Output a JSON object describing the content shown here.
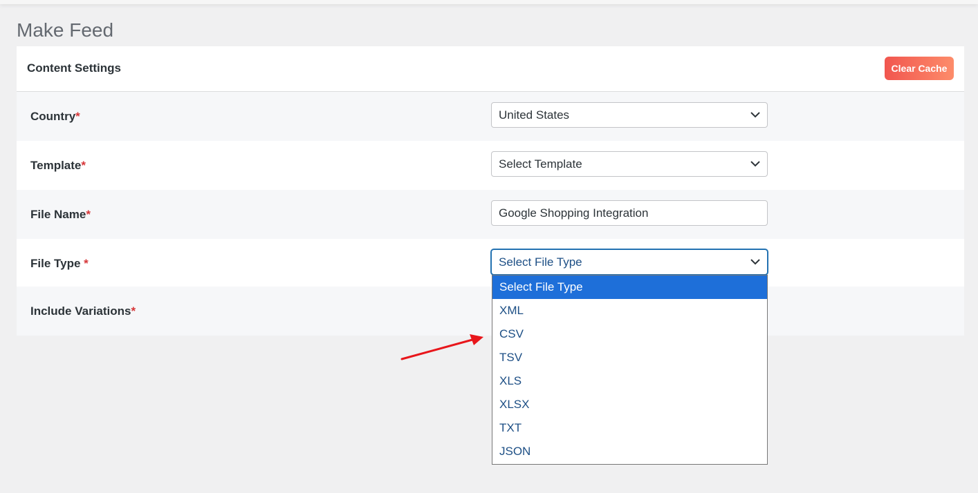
{
  "page": {
    "title": "Make Feed"
  },
  "panel": {
    "title": "Content Settings",
    "clear_cache_label": "Clear Cache"
  },
  "form": {
    "country": {
      "label": "Country",
      "required_mark": "*",
      "value": "United States"
    },
    "template": {
      "label": "Template",
      "required_mark": "*",
      "value": "Select Template"
    },
    "file_name": {
      "label": "File Name",
      "required_mark": "*",
      "value": "Google Shopping Integration"
    },
    "file_type": {
      "label": "File Type",
      "required_mark": "*",
      "value": "Select File Type"
    },
    "include_variations": {
      "label": "Include Variations",
      "required_mark": "*"
    }
  },
  "file_type_options": [
    "Select File Type",
    "XML",
    "CSV",
    "TSV",
    "XLS",
    "XLSX",
    "TXT",
    "JSON"
  ],
  "colors": {
    "accent": "#1e6fd9",
    "required": "#d63638",
    "button_gradient_start": "#f1564f",
    "button_gradient_end": "#fd8c6a",
    "annotation_arrow": "#e8161b"
  }
}
